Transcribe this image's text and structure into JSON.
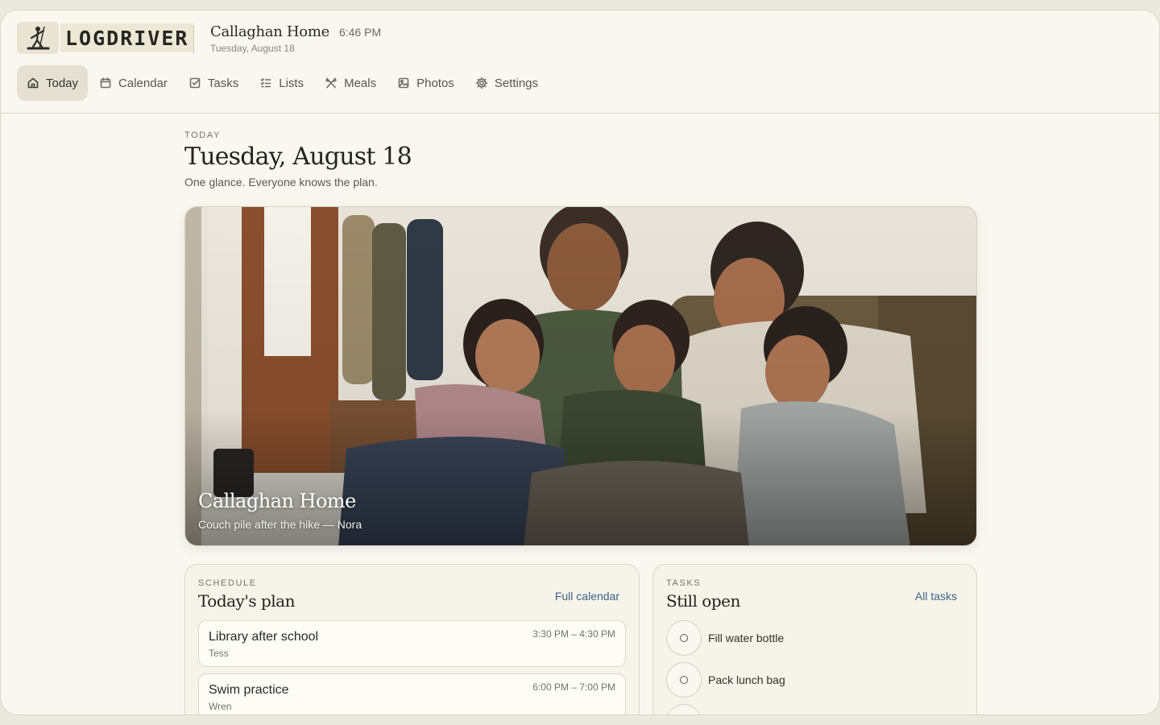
{
  "brand": {
    "name": "LOGDRIVER"
  },
  "home": {
    "name": "Callaghan Home",
    "time": "6:46 PM",
    "date": "Tuesday, August 18"
  },
  "nav": {
    "items": [
      {
        "label": "Today",
        "icon": "home-icon",
        "active": true
      },
      {
        "label": "Calendar",
        "icon": "calendar-icon"
      },
      {
        "label": "Tasks",
        "icon": "checkbox-icon"
      },
      {
        "label": "Lists",
        "icon": "list-icon"
      },
      {
        "label": "Meals",
        "icon": "utensils-icon"
      },
      {
        "label": "Photos",
        "icon": "image-icon"
      },
      {
        "label": "Settings",
        "icon": "gear-icon"
      }
    ]
  },
  "page": {
    "eyebrow": "TODAY",
    "title": "Tuesday, August 18",
    "subtitle": "One glance. Everyone knows the plan."
  },
  "hero": {
    "title": "Callaghan Home",
    "caption": "Couch pile after the hike — Nora"
  },
  "schedule": {
    "eyebrow": "SCHEDULE",
    "title": "Today's plan",
    "link": "Full calendar",
    "events": [
      {
        "name": "Library after school",
        "who": "Tess",
        "time": "3:30 PM – 4:30 PM"
      },
      {
        "name": "Swim practice",
        "who": "Wren",
        "time": "6:00 PM – 7:00 PM"
      }
    ]
  },
  "tasks": {
    "eyebrow": "TASKS",
    "title": "Still open",
    "link": "All tasks",
    "items": [
      {
        "label": "Fill water bottle"
      },
      {
        "label": "Pack lunch bag"
      },
      {
        "label": ""
      }
    ]
  },
  "colors": {
    "background": "#f9f7ef",
    "accent_link": "#3a6489",
    "active_nav": "#e4e1d3"
  }
}
